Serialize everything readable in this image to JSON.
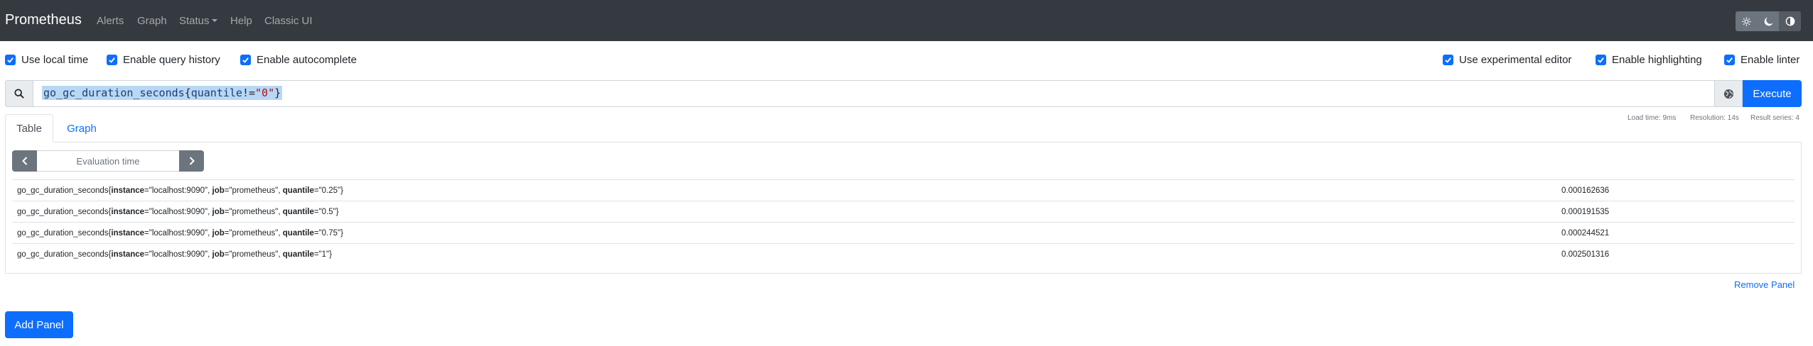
{
  "navbar": {
    "brand": "Prometheus",
    "links": {
      "alerts": "Alerts",
      "graph": "Graph",
      "status": "Status",
      "help": "Help",
      "classic": "Classic UI"
    },
    "theme_icons": [
      "sun-icon",
      "moon-icon",
      "contrast-icon"
    ]
  },
  "options": {
    "use_local_time": "Use local time",
    "query_history": "Enable query history",
    "autocomplete": "Enable autocomplete",
    "experimental_editor": "Use experimental editor",
    "highlighting": "Enable highlighting",
    "linter": "Enable linter"
  },
  "query": {
    "metric": "go_gc_duration_seconds",
    "open": "{",
    "label": "quantile",
    "op": "!=",
    "value": "\"0\"",
    "close": "}",
    "execute_label": "Execute"
  },
  "stats": {
    "load_time": "Load time: 9ms",
    "resolution": "Resolution: 14s",
    "result_series": "Result series: 4"
  },
  "tabs": {
    "table": "Table",
    "graph": "Graph"
  },
  "eval_time": {
    "placeholder": "Evaluation time"
  },
  "results": [
    {
      "metric": "go_gc_duration_seconds",
      "instance": "\"localhost:9090\"",
      "job": "\"prometheus\"",
      "quantile": "\"0.25\"",
      "value": "0.000162636"
    },
    {
      "metric": "go_gc_duration_seconds",
      "instance": "\"localhost:9090\"",
      "job": "\"prometheus\"",
      "quantile": "\"0.5\"",
      "value": "0.000191535"
    },
    {
      "metric": "go_gc_duration_seconds",
      "instance": "\"localhost:9090\"",
      "job": "\"prometheus\"",
      "quantile": "\"0.75\"",
      "value": "0.000244521"
    },
    {
      "metric": "go_gc_duration_seconds",
      "instance": "\"localhost:9090\"",
      "job": "\"prometheus\"",
      "quantile": "\"1\"",
      "value": "0.002501316"
    }
  ],
  "label_keys": {
    "instance": "instance",
    "job": "job",
    "quantile": "quantile"
  },
  "actions": {
    "remove_panel": "Remove Panel",
    "add_panel": "Add Panel"
  },
  "colors": {
    "primary": "#0d6efd",
    "navbar": "#343a40",
    "secondary": "#6c757d"
  }
}
